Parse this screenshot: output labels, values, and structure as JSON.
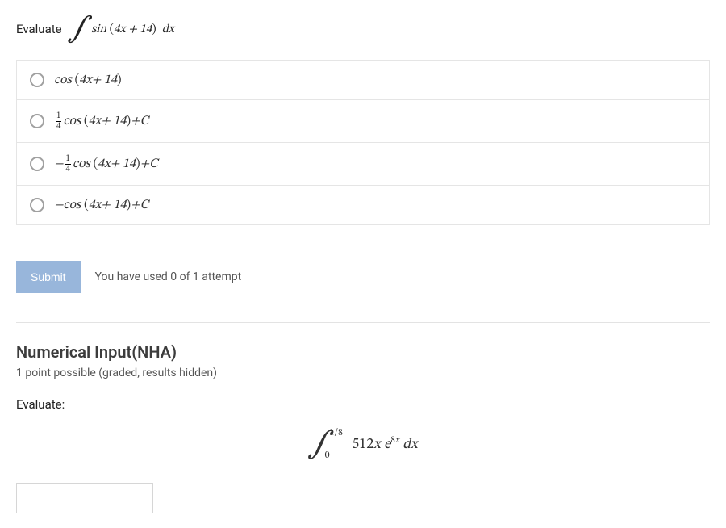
{
  "question1": {
    "prompt_prefix": "Evaluate",
    "integrand": "sin (4x + 14)  dx",
    "options": [
      {
        "id": "opt-a",
        "html": "cos (4x + 14)"
      },
      {
        "id": "opt-b",
        "html": "FRAC14 cos (4x + 14) + C"
      },
      {
        "id": "opt-c",
        "html": "−FRAC14 cos (4x + 14) + C"
      },
      {
        "id": "opt-d",
        "html": "−cos (4x + 14) + C"
      }
    ],
    "submit_label": "Submit",
    "attempts_text": "You have used 0 of 1 attempt"
  },
  "question2": {
    "title": "Numerical Input(NHA)",
    "subtitle": "1 point possible (graded, results hidden)",
    "prompt": "Evaluate:",
    "integral": {
      "lower": "0",
      "upper": "1/8",
      "body_plain": "512x e^{8x} dx"
    },
    "input_value": ""
  }
}
